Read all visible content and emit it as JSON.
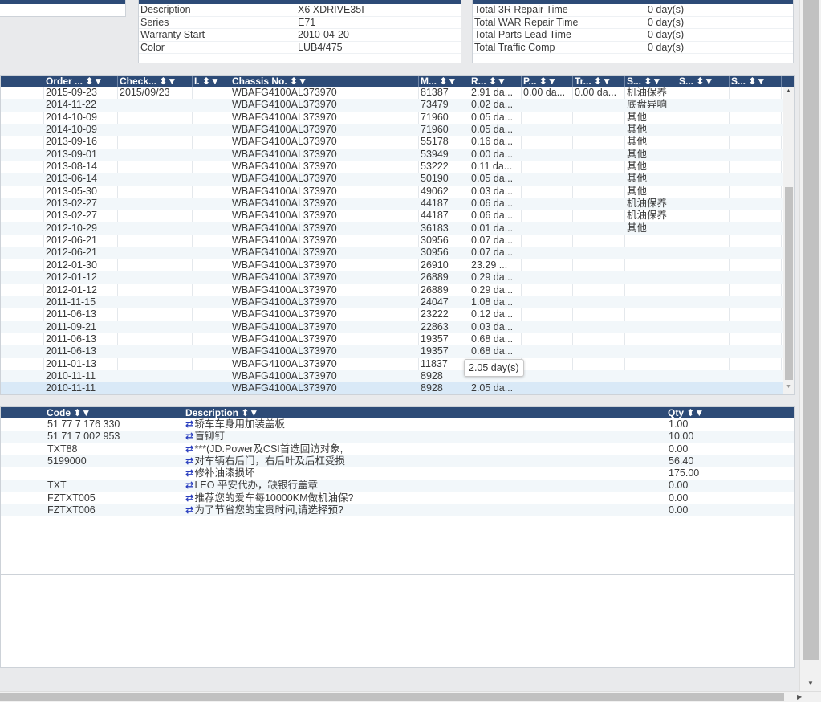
{
  "vehicle": {
    "fields": [
      {
        "label": "Description",
        "value": "X6 XDRIVE35I"
      },
      {
        "label": "Series",
        "value": "E71"
      },
      {
        "label": "Warranty Start",
        "value": "2010-04-20"
      },
      {
        "label": "Color",
        "value": "LUB4/475"
      }
    ]
  },
  "totals": {
    "fields": [
      {
        "label": "Total 3R Repair Time",
        "value": "0 day(s)"
      },
      {
        "label": "Total WAR Repair Time",
        "value": "0 day(s)"
      },
      {
        "label": "Total Parts Lead Time",
        "value": "0 day(s)"
      },
      {
        "label": "Total Traffic Comp",
        "value": "0 day(s)"
      }
    ]
  },
  "orders": {
    "headers": [
      "Order ... ⬍▼",
      "Check... ⬍▼",
      "I. ⬍▼",
      "Chassis No. ⬍▼",
      "M... ⬍▼",
      "R... ⬍▼",
      "P... ⬍▼",
      "Tr... ⬍▼",
      "S... ⬍▼",
      "S... ⬍▼",
      "S... ⬍▼"
    ],
    "rows": [
      [
        "2015-09-23",
        "2015/09/23",
        "",
        "WBAFG4100AL373970",
        "81387",
        "2.91 da...",
        "0.00 da...",
        "0.00 da...",
        "机油保养",
        "",
        ""
      ],
      [
        "2014-11-22",
        "",
        "",
        "WBAFG4100AL373970",
        "73479",
        "0.02 da...",
        "",
        "",
        "底盘异响",
        "",
        ""
      ],
      [
        "2014-10-09",
        "",
        "",
        "WBAFG4100AL373970",
        "71960",
        "0.05 da...",
        "",
        "",
        "其他",
        "",
        ""
      ],
      [
        "2014-10-09",
        "",
        "",
        "WBAFG4100AL373970",
        "71960",
        "0.05 da...",
        "",
        "",
        "其他",
        "",
        ""
      ],
      [
        "2013-09-16",
        "",
        "",
        "WBAFG4100AL373970",
        "55178",
        "0.16 da...",
        "",
        "",
        "其他",
        "",
        ""
      ],
      [
        "2013-09-01",
        "",
        "",
        "WBAFG4100AL373970",
        "53949",
        "0.00 da...",
        "",
        "",
        "其他",
        "",
        ""
      ],
      [
        "2013-08-14",
        "",
        "",
        "WBAFG4100AL373970",
        "53222",
        "0.11 da...",
        "",
        "",
        "其他",
        "",
        ""
      ],
      [
        "2013-06-14",
        "",
        "",
        "WBAFG4100AL373970",
        "50190",
        "0.05 da...",
        "",
        "",
        "其他",
        "",
        ""
      ],
      [
        "2013-05-30",
        "",
        "",
        "WBAFG4100AL373970",
        "49062",
        "0.03 da...",
        "",
        "",
        "其他",
        "",
        ""
      ],
      [
        "2013-02-27",
        "",
        "",
        "WBAFG4100AL373970",
        "44187",
        "0.06 da...",
        "",
        "",
        "机油保养",
        "",
        ""
      ],
      [
        "2013-02-27",
        "",
        "",
        "WBAFG4100AL373970",
        "44187",
        "0.06 da...",
        "",
        "",
        "机油保养",
        "",
        ""
      ],
      [
        "2012-10-29",
        "",
        "",
        "WBAFG4100AL373970",
        "36183",
        "0.01 da...",
        "",
        "",
        "其他",
        "",
        ""
      ],
      [
        "2012-06-21",
        "",
        "",
        "WBAFG4100AL373970",
        "30956",
        "0.07 da...",
        "",
        "",
        "",
        "",
        ""
      ],
      [
        "2012-06-21",
        "",
        "",
        "WBAFG4100AL373970",
        "30956",
        "0.07 da...",
        "",
        "",
        "",
        "",
        ""
      ],
      [
        "2012-01-30",
        "",
        "",
        "WBAFG4100AL373970",
        "26910",
        "23.29 ...",
        "",
        "",
        "",
        "",
        ""
      ],
      [
        "2012-01-12",
        "",
        "",
        "WBAFG4100AL373970",
        "26889",
        "0.29 da...",
        "",
        "",
        "",
        "",
        ""
      ],
      [
        "2012-01-12",
        "",
        "",
        "WBAFG4100AL373970",
        "26889",
        "0.29 da...",
        "",
        "",
        "",
        "",
        ""
      ],
      [
        "2011-11-15",
        "",
        "",
        "WBAFG4100AL373970",
        "24047",
        "1.08 da...",
        "",
        "",
        "",
        "",
        ""
      ],
      [
        "2011-06-13",
        "",
        "",
        "WBAFG4100AL373970",
        "23222",
        "0.12 da...",
        "",
        "",
        "",
        "",
        ""
      ],
      [
        "2011-09-21",
        "",
        "",
        "WBAFG4100AL373970",
        "22863",
        "0.03 da...",
        "",
        "",
        "",
        "",
        ""
      ],
      [
        "2011-06-13",
        "",
        "",
        "WBAFG4100AL373970",
        "19357",
        "0.68 da...",
        "",
        "",
        "",
        "",
        ""
      ],
      [
        "2011-06-13",
        "",
        "",
        "WBAFG4100AL373970",
        "19357",
        "0.68 da...",
        "",
        "",
        "",
        "",
        ""
      ],
      [
        "2011-01-13",
        "",
        "",
        "WBAFG4100AL373970",
        "11837",
        "",
        "",
        "",
        "",
        "",
        ""
      ],
      [
        "2010-11-11",
        "",
        "",
        "WBAFG4100AL373970",
        "8928",
        "",
        "",
        "",
        "",
        "",
        ""
      ],
      [
        "2010-11-11",
        "",
        "",
        "WBAFG4100AL373970",
        "8928",
        "2.05 da...",
        "",
        "",
        "",
        "",
        ""
      ]
    ],
    "selected_row": 24,
    "tooltip": "2.05 day(s)"
  },
  "parts": {
    "headers": [
      "Code ⬍▼",
      "Description ⬍▼",
      "Qty ⬍▼"
    ],
    "rows": [
      {
        "code": "51 77 7 176 330",
        "desc": "轿车车身用加装盖板",
        "qty": "1.00"
      },
      {
        "code": "51 71 7 002 953",
        "desc": "盲铆钉",
        "qty": "10.00"
      },
      {
        "code": "TXT88",
        "desc": "***(JD.Power及CSI首选回访对象,",
        "qty": "0.00"
      },
      {
        "code": "5199000",
        "desc": "对车辆右后门，右后叶及后杠受损",
        "qty": "56.40"
      },
      {
        "code": "",
        "desc": "修补油漆损坏",
        "qty": "175.00"
      },
      {
        "code": "TXT",
        "desc": "LEO 平安代办，缺银行盖章",
        "qty": "0.00"
      },
      {
        "code": "FZTXT005",
        "desc": "推荐您的爱车每10000KM做机油保?",
        "qty": "0.00"
      },
      {
        "code": "FZTXT006",
        "desc": "为了节省您的宝贵时间,请选择预?",
        "qty": "0.00"
      }
    ]
  },
  "colors": {
    "header": "#2d4b77",
    "swap_icon": "#2b3fbf"
  }
}
